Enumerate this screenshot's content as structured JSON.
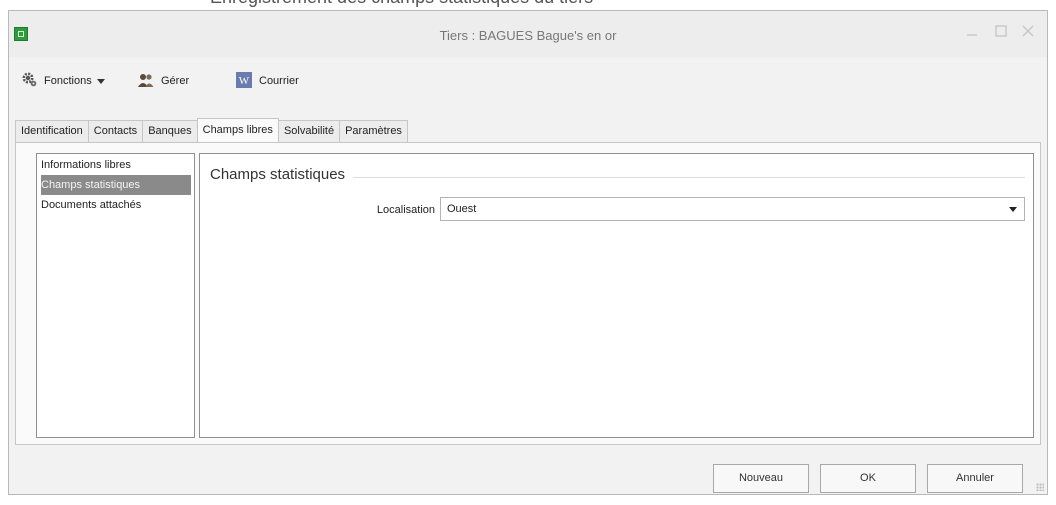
{
  "window": {
    "title": "Tiers : BAGUES Bague's en or",
    "controls": [
      "minimize",
      "maximize",
      "close"
    ]
  },
  "background_caption": "Enregistrement des champs statistiques du tiers",
  "toolbar": {
    "fonctions_label": "Fonctions",
    "gerer_label": "Gérer",
    "courrier_label": "Courrier"
  },
  "tabs": [
    {
      "label": "Identification"
    },
    {
      "label": "Contacts"
    },
    {
      "label": "Banques"
    },
    {
      "label": "Champs libres",
      "active": true
    },
    {
      "label": "Solvabilité"
    },
    {
      "label": "Paramètres"
    }
  ],
  "sidebar": {
    "items": [
      {
        "label": "Informations libres"
      },
      {
        "label": "Champs statistiques",
        "selected": true
      },
      {
        "label": "Documents attachés"
      }
    ]
  },
  "panel": {
    "group_title": "Champs statistiques",
    "localisation_label": "Localisation",
    "localisation_value": "Ouest"
  },
  "buttons": {
    "nouveau": "Nouveau",
    "ok": "OK",
    "annuler": "Annuler"
  },
  "icons": {
    "app": "app-green-icon",
    "fonctions": "gear-icon",
    "gerer": "users-icon",
    "courrier": "word-document-icon"
  },
  "colors": {
    "selected_item_bg": "#8a8a8a",
    "app_icon": "#2e9b3a",
    "word_icon": "#6a7bb0"
  }
}
